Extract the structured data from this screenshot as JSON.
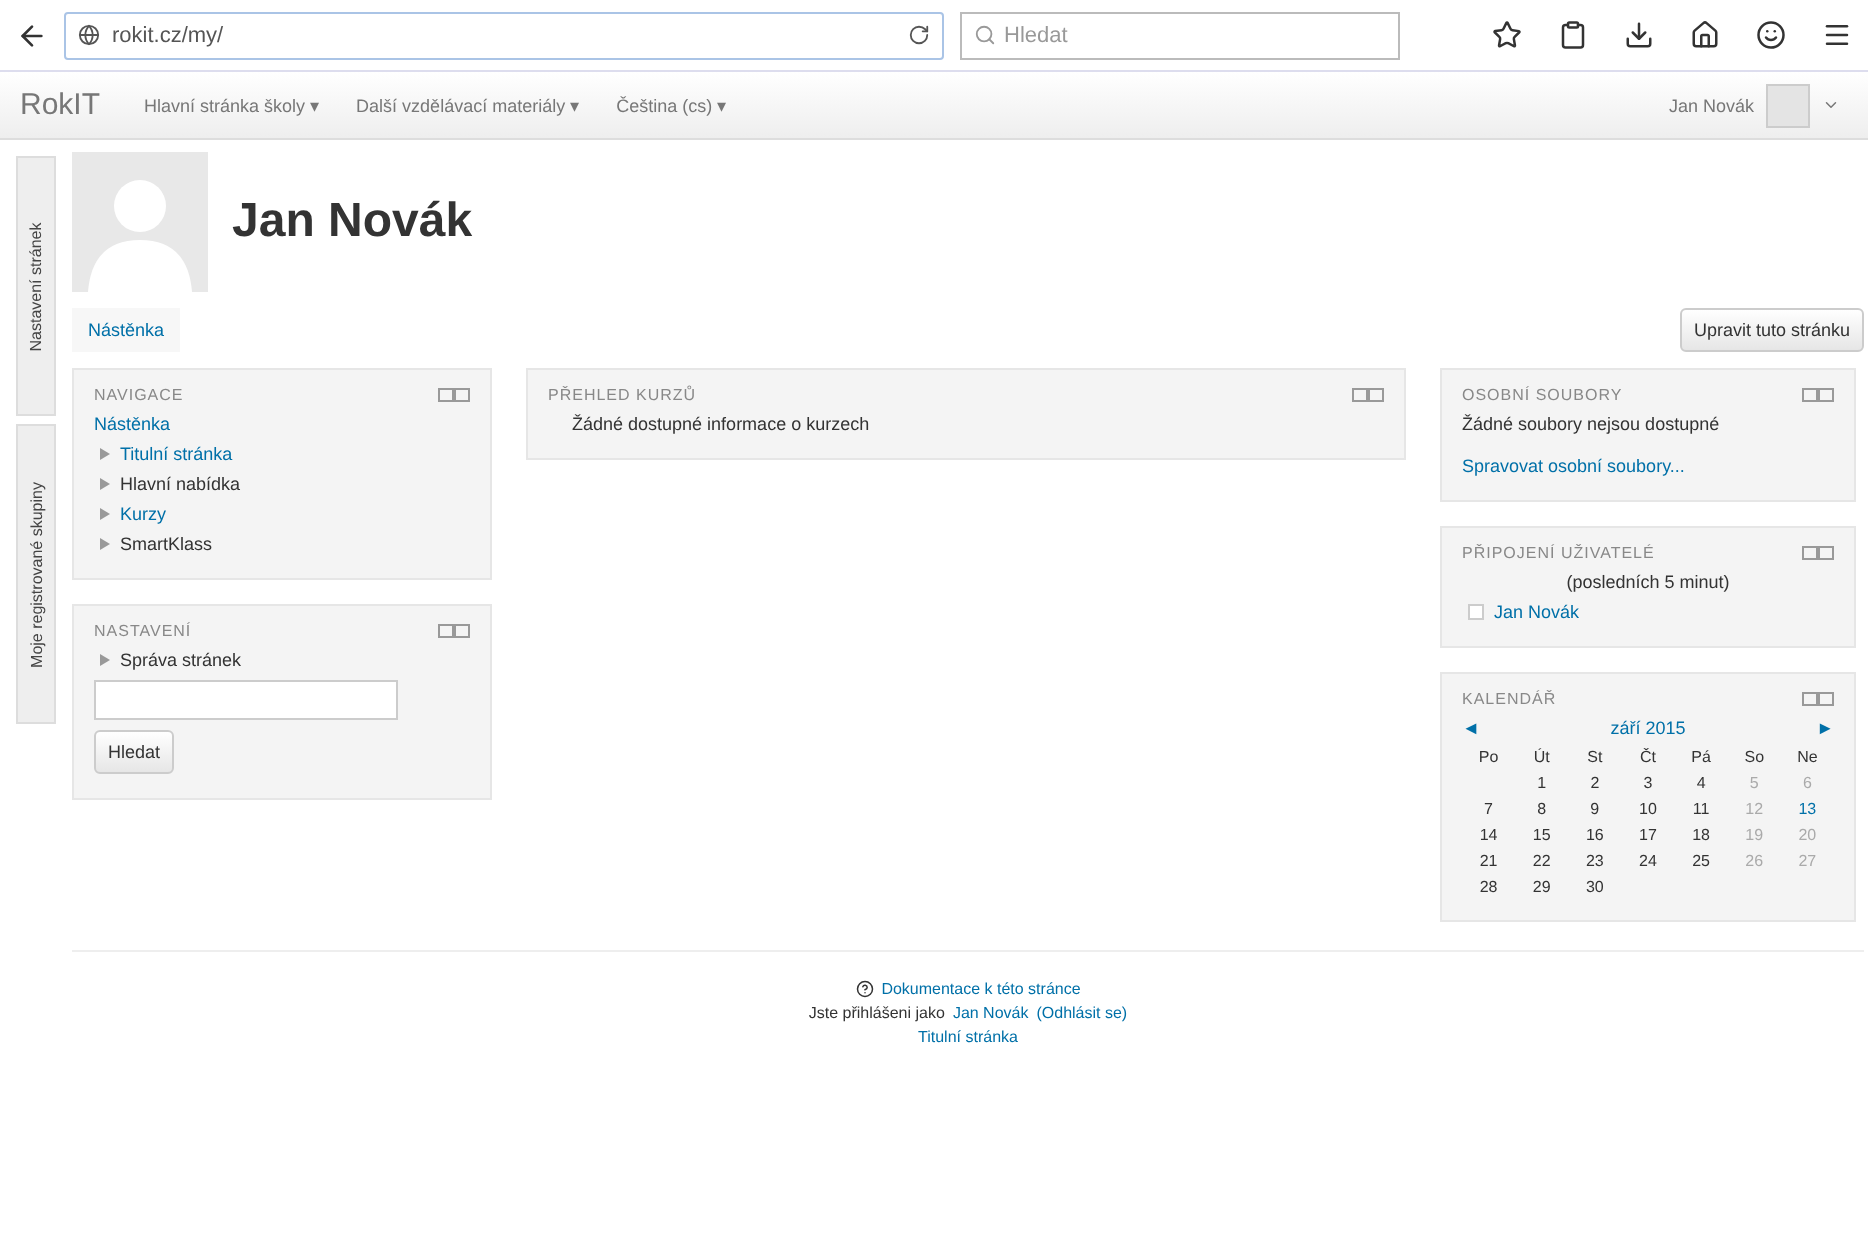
{
  "browser": {
    "url": "rokit.cz/my/",
    "search_placeholder": "Hledat"
  },
  "navbar": {
    "brand": "RokIT",
    "menus": [
      "Hlavní stránka školy ▾",
      "Další vzdělávací materiály ▾",
      "Čeština (cs) ▾"
    ],
    "user": "Jan Novák"
  },
  "side_tabs": [
    "Nastavení stránek",
    "Moje registrované skupiny"
  ],
  "profile": {
    "name": "Jan Novák",
    "tab": "Nástěnka",
    "edit_button": "Upravit tuto stránku"
  },
  "navigation": {
    "title": "NAVIGACE",
    "root": "Nástěnka",
    "items": [
      {
        "label": "Titulní stránka",
        "link": true
      },
      {
        "label": "Hlavní nabídka",
        "link": false
      },
      {
        "label": "Kurzy",
        "link": true
      },
      {
        "label": "SmartKlass",
        "link": false
      }
    ]
  },
  "settings": {
    "title": "NASTAVENÍ",
    "item": "Správa stránek",
    "search_button": "Hledat"
  },
  "courses": {
    "title": "PŘEHLED KURZŮ",
    "text": "Žádné dostupné informace o kurzech"
  },
  "files": {
    "title": "OSOBNÍ SOUBORY",
    "text": "Žádné soubory nejsou dostupné",
    "link": "Spravovat osobní soubory..."
  },
  "online": {
    "title": "PŘIPOJENÍ UŽIVATELÉ",
    "period": "(posledních 5 minut)",
    "users": [
      "Jan Novák"
    ]
  },
  "calendar": {
    "title": "KALENDÁŘ",
    "prev": "◄",
    "month": "září 2015",
    "next": "►",
    "weekdays": [
      "Po",
      "Út",
      "St",
      "Čt",
      "Pá",
      "So",
      "Ne"
    ],
    "weeks": [
      {
        "kind": "first",
        "days": [
          {
            "day": "1",
            "kind": "weekday"
          },
          {
            "day": "2",
            "kind": "weekday"
          },
          {
            "day": "3",
            "kind": "weekday"
          },
          {
            "day": "4",
            "kind": "weekday"
          },
          {
            "day": "5",
            "kind": "weekend"
          },
          {
            "day": "6",
            "kind": "weekend"
          }
        ]
      },
      {
        "kind": "week",
        "days": [
          {
            "day": "7",
            "kind": "weekday"
          },
          {
            "day": "8",
            "kind": "weekday"
          },
          {
            "day": "9",
            "kind": "weekday"
          },
          {
            "day": "10",
            "kind": "weekday"
          },
          {
            "day": "11",
            "kind": "weekday"
          },
          {
            "day": "12",
            "kind": "weekend"
          },
          {
            "day": "13",
            "kind": "today"
          }
        ]
      },
      {
        "kind": "week",
        "days": [
          {
            "day": "14",
            "kind": "weekday"
          },
          {
            "day": "15",
            "kind": "weekday"
          },
          {
            "day": "16",
            "kind": "weekday"
          },
          {
            "day": "17",
            "kind": "weekday"
          },
          {
            "day": "18",
            "kind": "weekday"
          },
          {
            "day": "19",
            "kind": "weekend"
          },
          {
            "day": "20",
            "kind": "weekend"
          }
        ]
      },
      {
        "kind": "week",
        "days": [
          {
            "day": "21",
            "kind": "weekday"
          },
          {
            "day": "22",
            "kind": "weekday"
          },
          {
            "day": "23",
            "kind": "weekday"
          },
          {
            "day": "24",
            "kind": "weekday"
          },
          {
            "day": "25",
            "kind": "weekday"
          },
          {
            "day": "26",
            "kind": "weekend"
          },
          {
            "day": "27",
            "kind": "weekend"
          }
        ]
      },
      {
        "kind": "week",
        "days": [
          {
            "day": "28",
            "kind": "weekday"
          },
          {
            "day": "29",
            "kind": "weekday"
          },
          {
            "day": "30",
            "kind": "weekday"
          }
        ]
      }
    ]
  },
  "footer": {
    "docs": "Dokumentace k této stránce",
    "login_prefix": "Jste přihlášeni jako",
    "login_user": "Jan Novák",
    "logout": "(Odhlásit se)",
    "home": "Titulní stránka"
  }
}
